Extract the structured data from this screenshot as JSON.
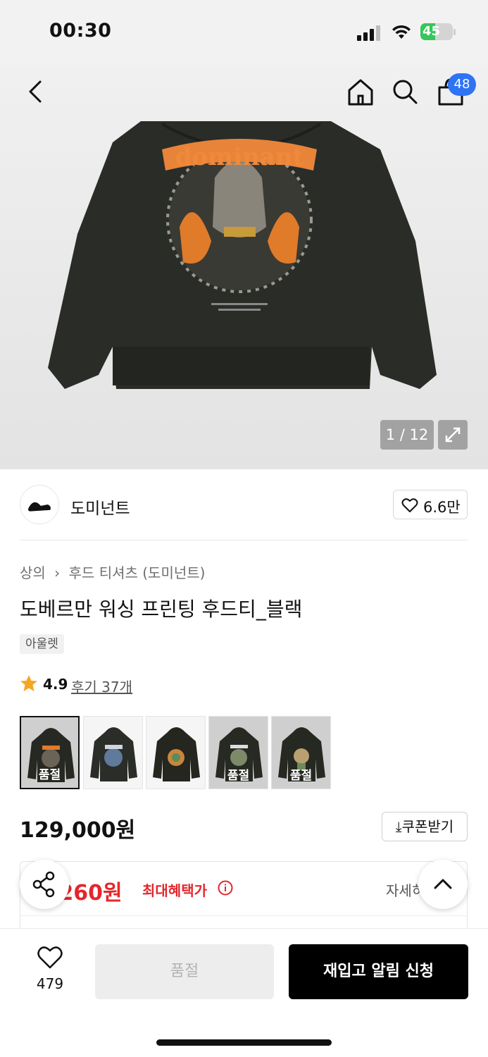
{
  "status_bar": {
    "time": "00:30",
    "battery": "45",
    "battery_level": 0.45
  },
  "nav": {
    "cart_count": "48"
  },
  "gallery": {
    "counter": "1 / 12"
  },
  "brand": {
    "name": "도미넌트",
    "likes": "6.6만"
  },
  "product": {
    "breadcrumb": [
      "상의",
      "후드 티셔츠 (도미넌트)"
    ],
    "title": "도베르만 워싱 프린팅 후드티_블랙",
    "badge": "아울렛",
    "rating": "4.9",
    "reviews": "후기 37개",
    "price": "129,000원"
  },
  "thumbnails": [
    {
      "label": "품절",
      "sold_out": true
    },
    {
      "label": "",
      "sold_out": false
    },
    {
      "label": "",
      "sold_out": false
    },
    {
      "label": "품절",
      "sold_out": true
    },
    {
      "label": "품절",
      "sold_out": true
    }
  ],
  "coupon": {
    "label": "쿠폰받기"
  },
  "benefit": {
    "price": ",260원",
    "label": "최대혜택가",
    "detail": "자세히"
  },
  "bottom": {
    "wish_count": "479",
    "soldout_label": "품절",
    "restock_label": "재입고 알림 신청"
  },
  "colors": {
    "accent_red": "#e4262b",
    "badge_blue": "#2f73f5",
    "star": "#f5a623"
  }
}
